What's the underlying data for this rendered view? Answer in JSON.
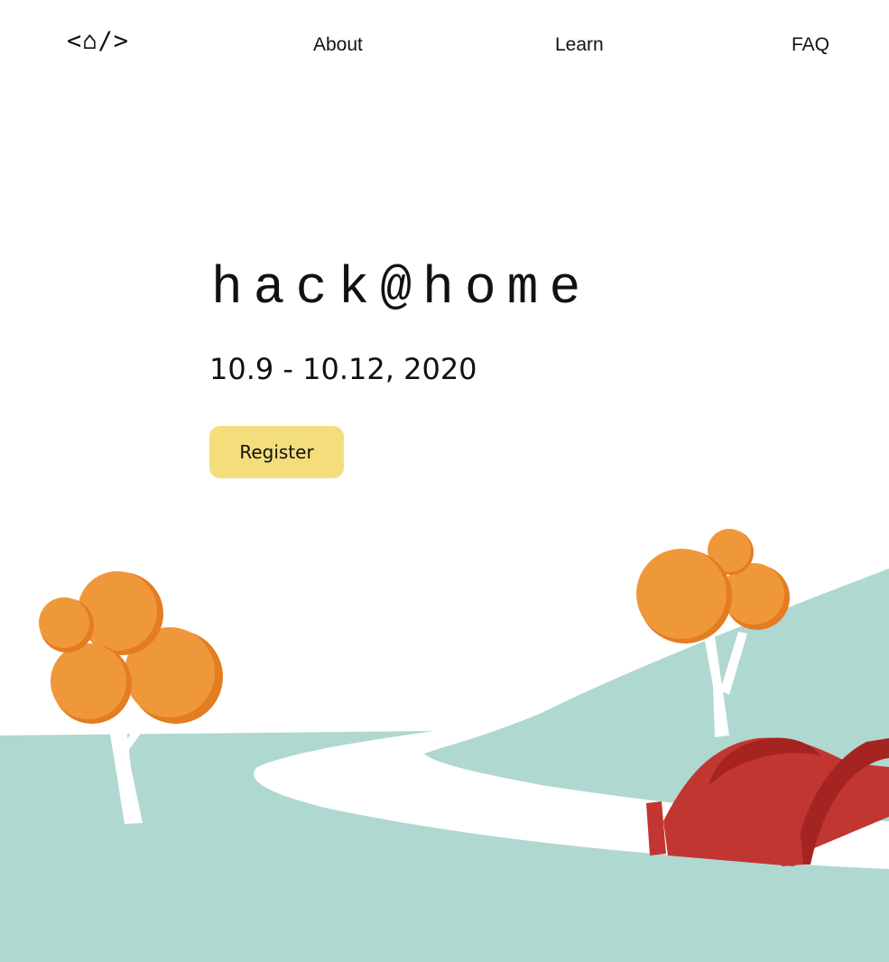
{
  "nav": {
    "logo": "<⌂/>",
    "links": [
      "About",
      "Learn",
      "FAQ"
    ]
  },
  "hero": {
    "title": "hack@home",
    "dates": "10.9 - 10.12, 2020",
    "register_label": "Register"
  },
  "colors": {
    "background": "#ffffff",
    "button": "#f4de7b",
    "ground": "#afd8d0",
    "tree_foliage": "#ef983a",
    "tree_shadow": "#e47c22",
    "tent": "#c23631",
    "tent_dark": "#a52422"
  }
}
